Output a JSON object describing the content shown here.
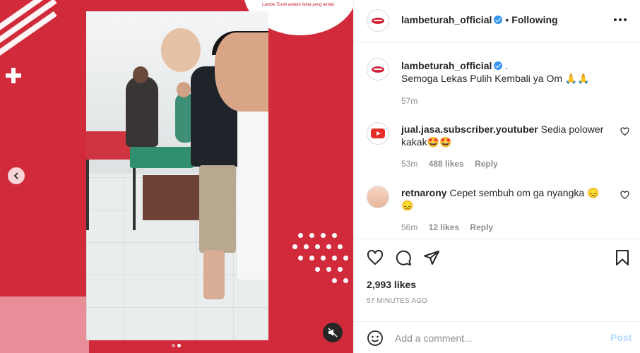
{
  "media": {
    "logo_tagline": "Lambe Turah adalah fakta yang terlalu",
    "carousel_current": 2,
    "carousel_total": 2,
    "prev_icon": "chevron-left-icon",
    "mute_icon": "speaker-muted-icon"
  },
  "header": {
    "username": "lambeturah_official",
    "separator": "•",
    "follow_label": "Following",
    "more_icon": "more-options-icon"
  },
  "caption": {
    "username": "lambeturah_official",
    "suffix": ".",
    "text": "Semoga Lekas Pulih Kembali ya Om 🙏🙏",
    "time": "57m"
  },
  "comments": [
    {
      "username": "jual.jasa.subscriber.youtuber",
      "text": "Sedia polower kakak🤩🤩",
      "time": "53m",
      "likes": "488 likes",
      "reply": "Reply"
    },
    {
      "username": "retnarony",
      "text": "Cepet sembuh om ga nyangka 😞😞",
      "time": "56m",
      "likes": "12 likes",
      "reply": "Reply"
    }
  ],
  "actions": {
    "icons": [
      "heart-icon",
      "comment-icon",
      "share-icon",
      "bookmark-icon"
    ],
    "likes": "2,993 likes",
    "posted_ago": "57 MINUTES AGO"
  },
  "add_comment": {
    "placeholder": "Add a comment...",
    "post_label": "Post"
  },
  "colors": {
    "accent_red": "#d12a3a",
    "verified_blue": "#3897f0",
    "post_disabled": "#b3dbff",
    "meta_gray": "#8e8e8e"
  }
}
